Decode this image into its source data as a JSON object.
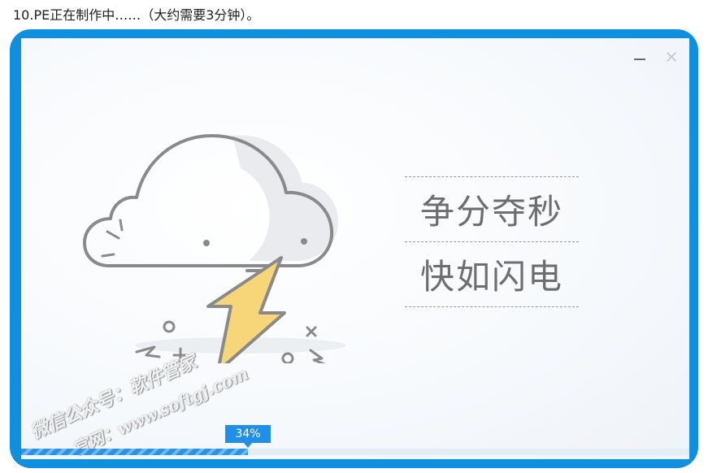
{
  "caption": "10.PE正在制作中……（大约需要3分钟）。",
  "window": {
    "minimize_icon": "minimize-icon",
    "close_icon": "close-icon"
  },
  "illustration": {
    "icon": "cloud-lightning-icon"
  },
  "slogan": {
    "line1": "争分夺秒",
    "line2": "快如闪电"
  },
  "watermark": {
    "line1": "微信公众号：软件管家",
    "line2": "官网：www.softgj.com"
  },
  "progress": {
    "value": 0.34,
    "label": "34%"
  },
  "colors": {
    "frame": "#0e8fe0",
    "accent": "#1f8fe8",
    "bolt": "#f7d67a",
    "stroke": "#8a8a8a"
  }
}
